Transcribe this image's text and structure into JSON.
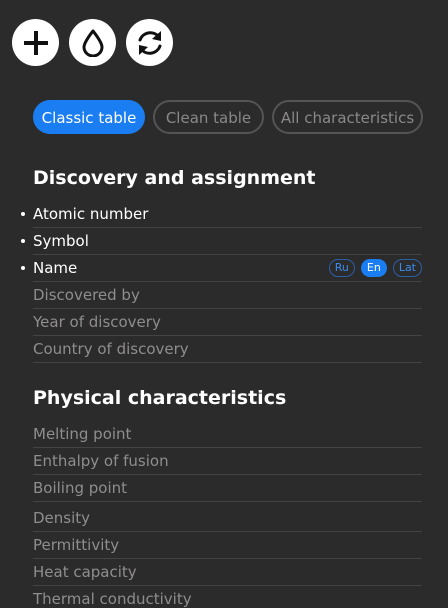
{
  "toolbar": {
    "add_icon": "plus-icon",
    "drop_icon": "drop-icon",
    "refresh_icon": "refresh-icon"
  },
  "tabs": [
    {
      "label": "Classic table",
      "active": true
    },
    {
      "label": "Clean table",
      "active": false
    },
    {
      "label": "All characteristics",
      "active": false
    }
  ],
  "sections": {
    "discovery": {
      "title": "Discovery and assignment",
      "rows": [
        {
          "label": "Atomic number",
          "selected": true
        },
        {
          "label": "Symbol",
          "selected": true
        },
        {
          "label": "Name",
          "selected": true
        },
        {
          "label": "Discovered by",
          "selected": false
        },
        {
          "label": "Year of discovery",
          "selected": false
        },
        {
          "label": "Country of discovery",
          "selected": false
        }
      ]
    },
    "physical": {
      "title": "Physical characteristics",
      "rows": [
        {
          "label": "Melting point",
          "selected": false
        },
        {
          "label": "Enthalpy of fusion",
          "selected": false
        },
        {
          "label": "Boiling point",
          "selected": false
        },
        {
          "label": "Density",
          "selected": false
        },
        {
          "label": "Permittivity",
          "selected": false
        },
        {
          "label": "Heat capacity",
          "selected": false
        },
        {
          "label": "Thermal conductivity",
          "selected": false
        }
      ]
    }
  },
  "languages": [
    {
      "label": "Ru",
      "active": false
    },
    {
      "label": "En",
      "active": true
    },
    {
      "label": "Lat",
      "active": false
    }
  ],
  "colors": {
    "background": "#2c2b2b",
    "accent": "#1a7ef2",
    "inactive_text": "#8f8d8d"
  }
}
